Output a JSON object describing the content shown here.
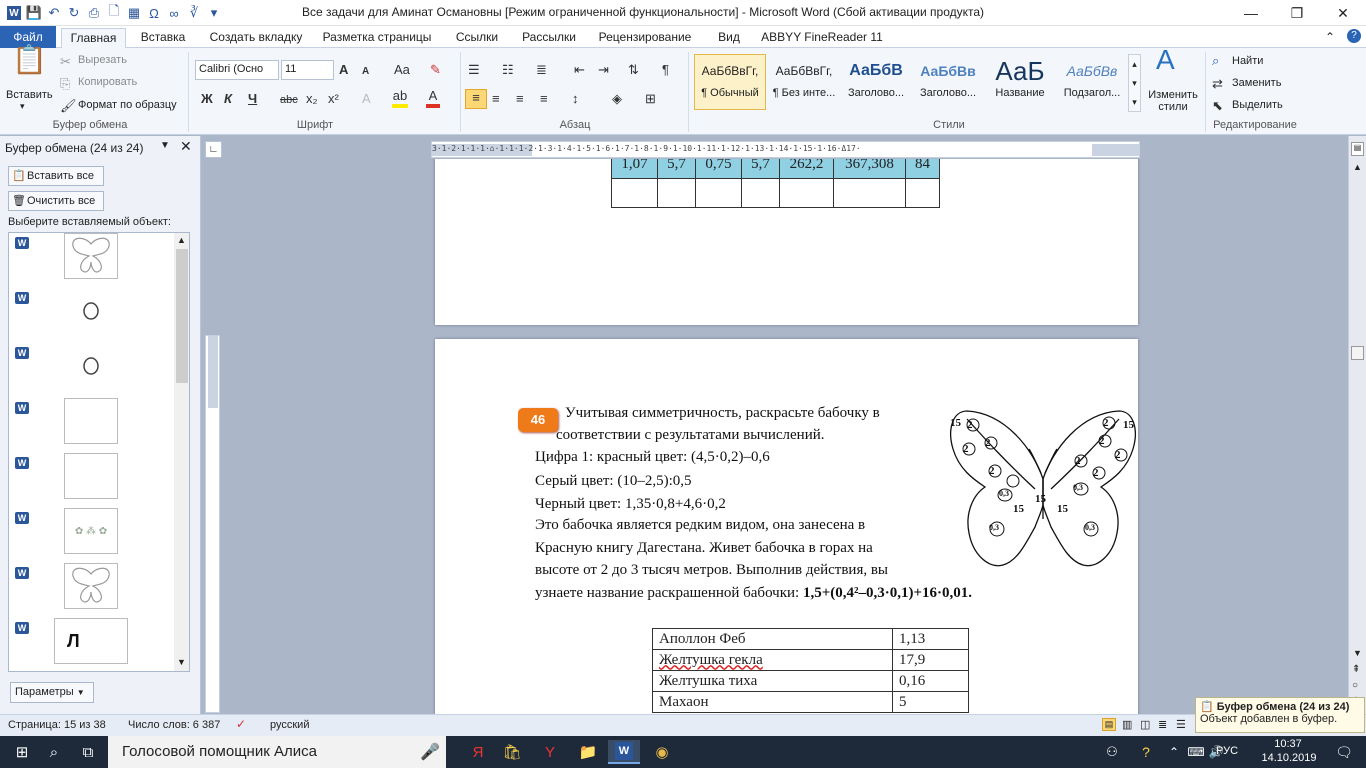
{
  "titlebar": {
    "title": "Все задачи для Аминат Османовны [Режим ограниченной функциональности]  -  Microsoft Word (Сбой активации продукта)",
    "minimize": "—",
    "maximize": "❐",
    "close": "✕"
  },
  "tabs": [
    "Файл",
    "Главная",
    "Вставка",
    "Создать вкладку",
    "Разметка страницы",
    "Ссылки",
    "Рассылки",
    "Рецензирование",
    "Вид",
    "ABBYY FineReader 11"
  ],
  "ribbon": {
    "clipboard": {
      "paste": "Вставить",
      "cut": "Вырезать",
      "copy": "Копировать",
      "format_painter": "Формат по образцу",
      "label": "Буфер обмена"
    },
    "font": {
      "name": "Calibri (Осно",
      "size": "11",
      "label": "Шрифт",
      "bold": "Ж",
      "italic": "К",
      "underline": "Ч",
      "strike": "abc",
      "sub": "x₂",
      "sup": "x²",
      "grow": "A",
      "shrink": "A",
      "case": "Aa"
    },
    "paragraph": {
      "label": "Абзац",
      "pilcrow": "¶"
    },
    "styles": {
      "label": "Стили",
      "items": [
        {
          "sample": "АаБбВвГг,",
          "name": "¶ Обычный"
        },
        {
          "sample": "АаБбВвГг,",
          "name": "¶ Без инте..."
        },
        {
          "sample": "АаБбВ",
          "name": "Заголово..."
        },
        {
          "sample": "АаБбВв",
          "name": "Заголово..."
        },
        {
          "sample": "АаБ",
          "name": "Название"
        },
        {
          "sample": "АаБбВв",
          "name": "Подзагол..."
        }
      ],
      "change": "Изменить стили"
    },
    "editing": {
      "label": "Редактирование",
      "find": "Найти",
      "replace": "Заменить",
      "select": "Выделить"
    }
  },
  "clipboard_pane": {
    "title": "Буфер обмена (24 из 24)",
    "paste_all": "Вставить все",
    "clear_all": "Очистить все",
    "prompt": "Выберите вставляемый объект:",
    "items": [
      "butterfly",
      "circle",
      "circle",
      "blank",
      "blank",
      "flowers",
      "butterfly",
      "Л"
    ],
    "params": "Параметры"
  },
  "document": {
    "top_table": {
      "row1": [
        "1,07",
        "5,7",
        "0,75",
        "5,7",
        "262,2",
        "367,308",
        "84"
      ],
      "row2": [
        "",
        "",
        "",
        "",
        "",
        "",
        ""
      ]
    },
    "task_number": "46",
    "lines": [
      "Учитывая симметричность, раскрасьте бабочку в",
      "соответствии с результатами вычислений.",
      "Цифра 1: красный цвет: (4,5·0,2)–0,6",
      "Серый цвет: (10–2,5):0,5",
      "Черный цвет: 1,35·0,8+4,6·0,2",
      "Это бабочка является редким видом, она занесена в",
      "Красную книгу Дагестана. Живет бабочка в горах на",
      "высоте от 2 до 3 тысяч метров. Выполнив действия, вы",
      "узнаете название раскрашенной бабочки: "
    ],
    "expression": "1,5+(0,4²–0,3·0,1)+16·0,01.",
    "butterfly_labels": [
      "15",
      "2",
      "2",
      "2",
      "2",
      "15",
      "15",
      "15",
      "2",
      "2",
      "2",
      "2",
      "2",
      "15",
      "0,3",
      "0,3",
      "0,3",
      "0,3"
    ],
    "answer_table": [
      [
        "Аполлон Феб",
        "1,13"
      ],
      [
        "Желтушка гекла",
        "17,9"
      ],
      [
        "Желтушка тиха",
        "0,16"
      ],
      [
        "Махаон",
        "5"
      ]
    ]
  },
  "statusbar": {
    "page": "Страница: 15 из 38",
    "words": "Число слов: 6 387",
    "lang": "русский"
  },
  "notification": {
    "title": "Буфер обмена (24 из 24)",
    "text": "Объект добавлен в буфер."
  },
  "taskbar": {
    "search": "Голосовой помощник Алиса",
    "lang": "РУС",
    "time": "10:37",
    "date": "14.10.2019"
  }
}
